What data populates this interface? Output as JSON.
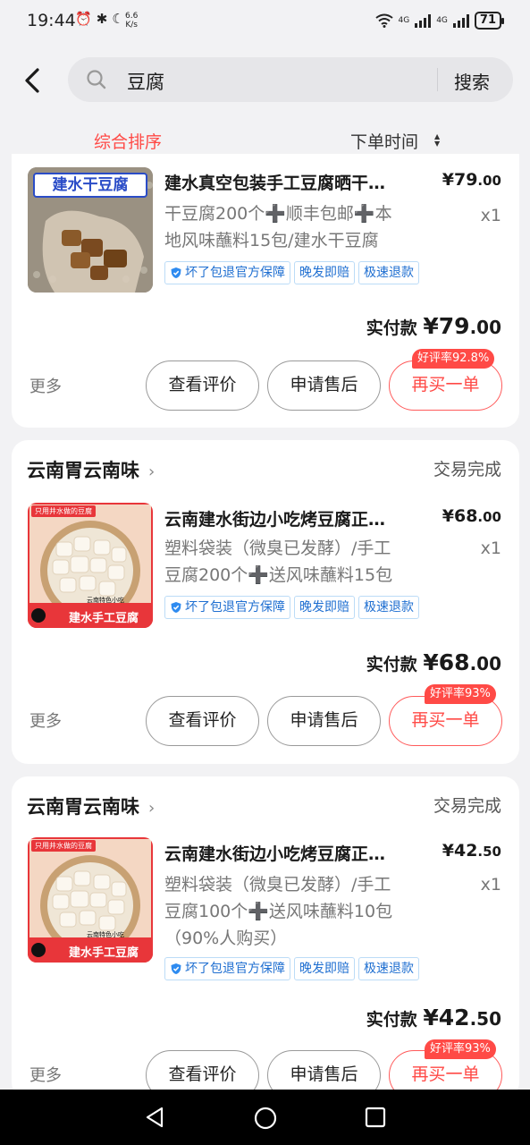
{
  "status_bar": {
    "time": "19:44",
    "speed_top": "6.6",
    "speed_bottom": "K/s",
    "net1": "4G",
    "net2": "4G",
    "battery": "71"
  },
  "search": {
    "query": "豆腐",
    "button": "搜索"
  },
  "sort": {
    "option1": "综合排序",
    "option2": "下单时间"
  },
  "colors": {
    "accent": "#ff4a46",
    "tag_blue": "#1f6fd1",
    "background": "#f2f2f4"
  },
  "orders": [
    {
      "title": "建水真空包装手工豆腐晒干…",
      "price_int": "¥79",
      "price_dec": ".00",
      "desc1": "干豆腐200个➕顺丰包邮➕本",
      "desc2": "地风味蘸料15包/建水干豆腐",
      "desc3": "",
      "qty": "x1",
      "tags": [
        "坏了包退官方保障",
        "晚发即赔",
        "极速退款"
      ],
      "paid_label": "实付款",
      "paid_int": "¥79",
      "paid_dec": ".00",
      "more": "更多",
      "btn1": "查看评价",
      "btn2": "申请售后",
      "btn3": "再买一单",
      "badge": "好评率92.8%",
      "thumb_text": "建水干豆腐"
    },
    {
      "shop": "云南胃云南味",
      "status": "交易完成",
      "title": "云南建水街边小吃烤豆腐正…",
      "price_int": "¥68",
      "price_dec": ".00",
      "desc1": "塑料袋装（微臭已发酵）/手工",
      "desc2": "豆腐200个➕送风味蘸料15包",
      "desc3": "",
      "qty": "x1",
      "tags": [
        "坏了包退官方保障",
        "晚发即赔",
        "极速退款"
      ],
      "paid_label": "实付款",
      "paid_int": "¥68",
      "paid_dec": ".00",
      "more": "更多",
      "btn1": "查看评价",
      "btn2": "申请售后",
      "btn3": "再买一单",
      "badge": "好评率93%",
      "thumb_top": "只用井水做的豆腐",
      "thumb_bottom": "建水手工豆腐",
      "thumb_sub": "云南特色小吃"
    },
    {
      "shop": "云南胃云南味",
      "status": "交易完成",
      "title": "云南建水街边小吃烤豆腐正…",
      "price_int": "¥42",
      "price_dec": ".50",
      "desc1": "塑料袋装（微臭已发酵）/手工",
      "desc2": "豆腐100个➕送风味蘸料10包",
      "desc3": "（90%人购买）",
      "qty": "x1",
      "tags": [
        "坏了包退官方保障",
        "晚发即赔",
        "极速退款"
      ],
      "paid_label": "实付款",
      "paid_int": "¥42",
      "paid_dec": ".50",
      "more": "更多",
      "btn1": "查看评价",
      "btn2": "申请售后",
      "btn3": "再买一单",
      "badge": "好评率93%",
      "thumb_top": "只用井水做的豆腐",
      "thumb_bottom": "建水手工豆腐",
      "thumb_sub": "云南特色小吃"
    }
  ]
}
